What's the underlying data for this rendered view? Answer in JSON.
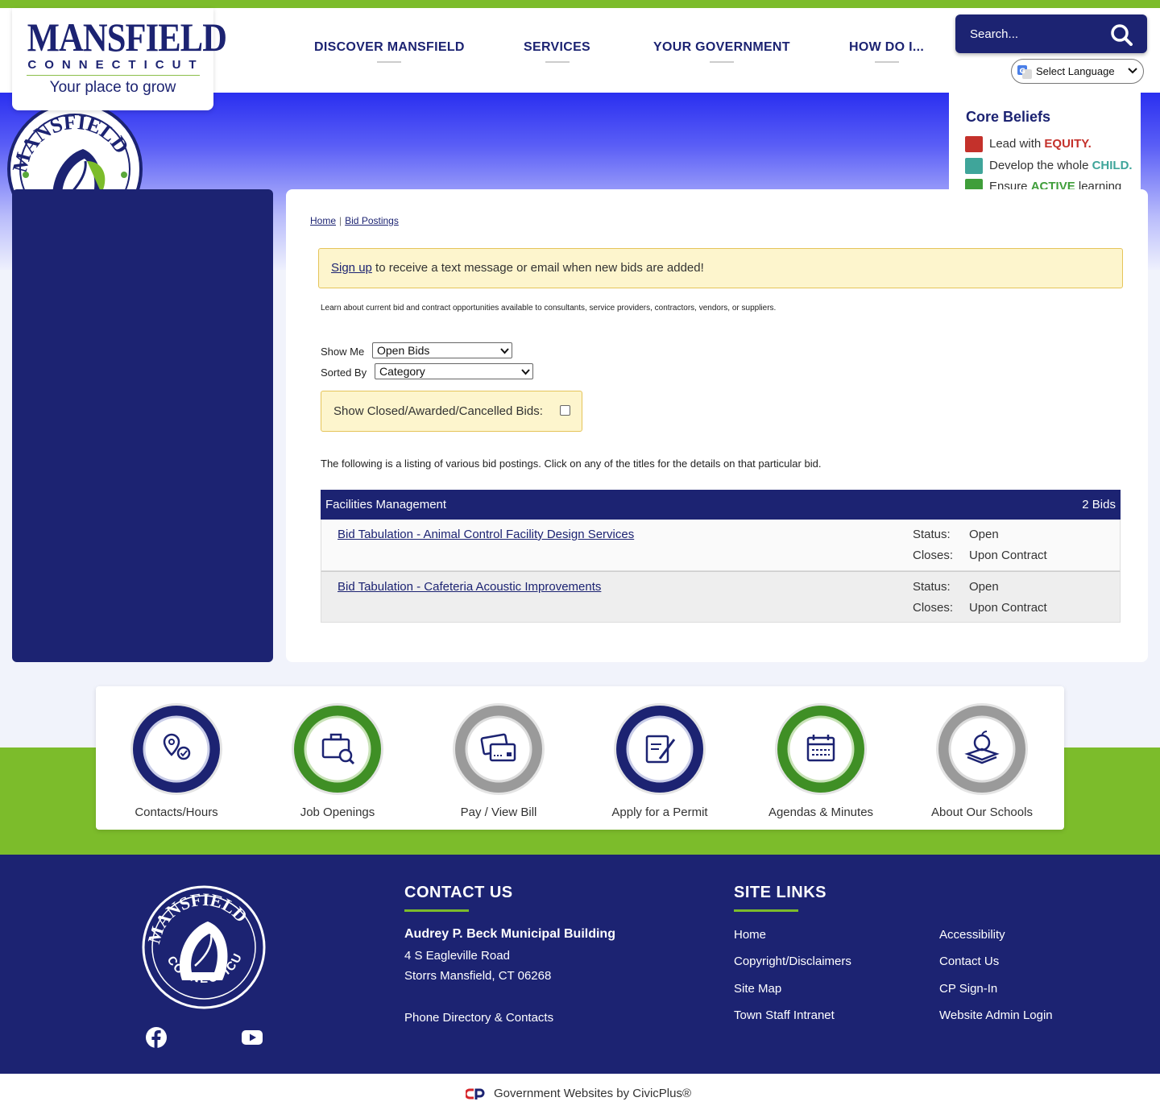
{
  "header": {
    "logo_word": "MANSFIELD",
    "logo_state": "CONNECTICUT",
    "logo_tagline": "Your place to grow",
    "nav": [
      {
        "label": "DISCOVER MANSFIELD"
      },
      {
        "label": "SERVICES"
      },
      {
        "label": "YOUR GOVERNMENT"
      },
      {
        "label": "HOW DO I..."
      }
    ],
    "search_placeholder": "Search...",
    "language_label": "Select Language"
  },
  "core_beliefs": {
    "title": "Core Beliefs",
    "items": [
      {
        "pre": "Lead with ",
        "bold": "EQUITY.",
        "color": "#c4312b"
      },
      {
        "pre": "Develop the whole ",
        "bold": "CHILD.",
        "color": "#3fa59a"
      },
      {
        "pre": "Ensure ",
        "bold": "ACTIVE",
        "post": " learning",
        "color": "#3f9e3a"
      }
    ]
  },
  "breadcrumb": {
    "home": "Home",
    "current": "Bid Postings"
  },
  "alert": {
    "link": "Sign up",
    "text": " to receive a text message or email when new bids are added!"
  },
  "intro": "Learn about current bid and contract opportunities available to consultants, service providers, contractors, vendors, or suppliers.",
  "filters": {
    "show_me_label": "Show Me",
    "show_me_value": "Open Bids",
    "sorted_by_label": "Sorted By",
    "sorted_by_value": "Category",
    "closed_label": "Show Closed/Awarded/Cancelled Bids:"
  },
  "listing_text": "The following is a listing of various bid postings. Click on any of the titles for the details on that particular bid.",
  "bids_category": {
    "name": "Facilities Management",
    "count": "2 Bids",
    "status_label": "Status:",
    "closes_label": "Closes:",
    "items": [
      {
        "title": "Bid Tabulation - Animal Control Facility Design Services",
        "status": "Open",
        "closes": "Upon Contract"
      },
      {
        "title": "Bid Tabulation - Cafeteria Acoustic Improvements",
        "status": "Open",
        "closes": "Upon Contract"
      }
    ]
  },
  "quick_links": [
    {
      "label": "Contacts/Hours",
      "icon": "location-check-icon",
      "color": "#1c2372"
    },
    {
      "label": "Job Openings",
      "icon": "briefcase-search-icon",
      "color": "#3f8f25"
    },
    {
      "label": "Pay / View Bill",
      "icon": "credit-card-icon",
      "color": "#9a9a9a"
    },
    {
      "label": "Apply for a Permit",
      "icon": "clipboard-pen-icon",
      "color": "#1c2372"
    },
    {
      "label": "Agendas & Minutes",
      "icon": "calendar-icon",
      "color": "#3f8f25"
    },
    {
      "label": "About Our Schools",
      "icon": "apple-books-icon",
      "color": "#9a9a9a"
    }
  ],
  "footer": {
    "seal_top": "MANSFIELD",
    "seal_bottom": "CONNECTICUT",
    "contact_heading": "CONTACT US",
    "building": "Audrey P. Beck Municipal Building",
    "address1": "4 S Eagleville Road",
    "address2": "Storrs Mansfield, CT 06268",
    "phone_link": "Phone Directory & Contacts",
    "site_links_heading": "SITE LINKS",
    "links_col1": [
      "Home",
      "Copyright/Disclaimers",
      "Site Map",
      "Town Staff Intranet"
    ],
    "links_col2": [
      "Accessibility",
      "Contact Us",
      "CP Sign-In",
      "Website Admin Login"
    ]
  },
  "credit": "Government Websites by CivicPlus®",
  "colors": {
    "navy": "#1c2372",
    "green": "#7cbc2b",
    "alert_bg": "#fdf5cd"
  }
}
